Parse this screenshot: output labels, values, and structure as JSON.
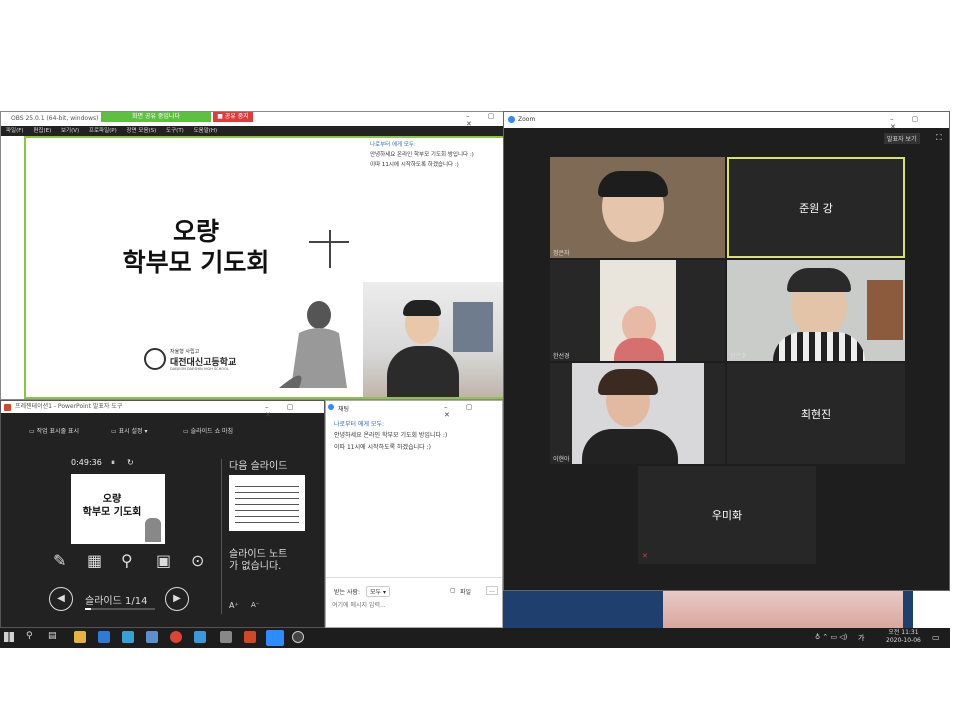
{
  "obs": {
    "title": "OBS 25.0.1 (64-bit, windows) -",
    "share_badge": "화면 공유 중입니다",
    "stop_badge": "■ 공유 중지",
    "menu": [
      "파일(F)",
      "편집(E)",
      "보기(V)",
      "프로파일(P)",
      "장면 모음(S)",
      "도구(T)",
      "도움말(H)"
    ],
    "slide_title_1": "오량",
    "slide_title_2": "학부모 기도회",
    "school_small": "자율형 사립고",
    "school_name": "대전대신고등학교",
    "school_en": "DAEJEON DAESHIN HIGH SCHOOL",
    "chat_line_1": "나로부터 에게 모두:",
    "chat_line_2": "안녕하세요 온라인 학부모 기도회 방입니다 :)",
    "chat_line_3": "이따 11시에 시작하도록 하겠습니다 :)"
  },
  "zoom": {
    "title": "Zoom",
    "speaker_view": "발표자 보기",
    "participants": [
      {
        "label": "정은자",
        "type": "video"
      },
      {
        "label": "준원 강",
        "type": "name"
      },
      {
        "label": "한선경",
        "type": "video"
      },
      {
        "label": "장은주",
        "type": "video"
      },
      {
        "label": "이현아",
        "type": "video"
      },
      {
        "label": "최현진",
        "type": "name"
      },
      {
        "label": "우미화",
        "type": "name"
      }
    ]
  },
  "ppt": {
    "title": "프레젠테이션1 - PowerPoint 발표자 도구",
    "btn_taskbar": "작업 표시줄 표시",
    "btn_display": "표시 설정 ▾",
    "btn_end": "슬라이드 쇼 마침",
    "timer": "0:49:36",
    "next_label": "다음 슬라이드",
    "thumb_title_1": "오량",
    "thumb_title_2": "학부모 기도회",
    "notes": "슬라이드 노트가 없습니다.",
    "counter": "슬라이드 1/14"
  },
  "chat": {
    "title": "채팅",
    "line_1": "나로부터 에게 모두:",
    "line_2": "안녕하세요 온라인 학부모 기도회 방입니다 :)",
    "line_3": "이따 11시에 시작하도록 하겠습니다 :)",
    "to_label": "받는 사람:",
    "to_value": "모두 ▾",
    "file_label": "파일",
    "placeholder": "여기에 메시지 입력..."
  },
  "taskbar": {
    "time": "오전 11:31",
    "date": "2020-10-06",
    "lang": "가"
  },
  "colors": {
    "obs_green": "#5cc23e",
    "obs_red": "#e23a3a",
    "zoom_dark": "#1e1e1e",
    "active_speaker": "#d8e36a"
  }
}
